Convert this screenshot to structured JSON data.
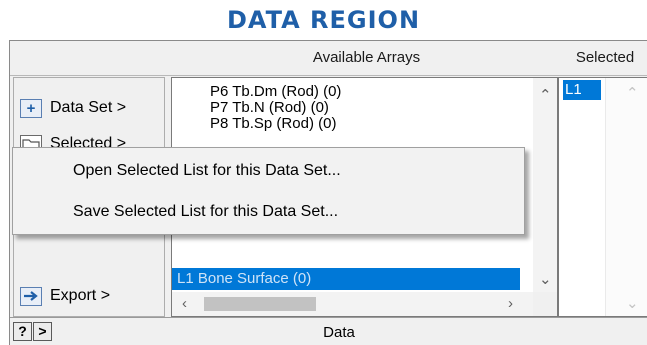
{
  "heading": "DATA REGION",
  "headers": {
    "available": "Available Arrays",
    "selected": "Selected"
  },
  "side_buttons": [
    {
      "label": "Data Set >",
      "icon": "plus-icon"
    },
    {
      "label": "Selected >",
      "icon": "folder-icon"
    },
    {
      "label": "Export >",
      "icon": "arrow-right-icon"
    }
  ],
  "available_arrays": {
    "items": [
      "P6 Tb.Dm (Rod) (0)",
      "P7 Tb.N (Rod) (0)",
      "P8 Tb.Sp (Rod) (0)"
    ],
    "selected_item": "L1 Bone Surface (0)"
  },
  "selected_list": {
    "items": [
      "L1"
    ]
  },
  "context_menu": {
    "items": [
      "Open Selected List for this Data Set...",
      "Save Selected List for this Data Set..."
    ]
  },
  "statusbar": {
    "help_label": "?",
    "next_label": ">",
    "text": "Data"
  },
  "colors": {
    "heading": "#1f5fa8",
    "selection": "#0078d7",
    "panel": "#f0f0f0"
  }
}
